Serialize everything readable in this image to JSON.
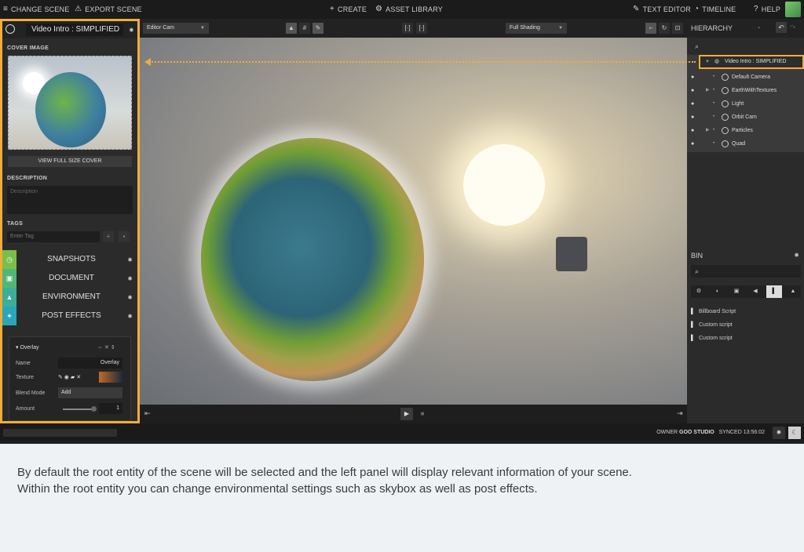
{
  "topbar": {
    "change_scene": "CHANGE SCENE",
    "export_scene": "EXPORT SCENE",
    "create": "CREATE",
    "asset_library": "ASSET LIBRARY",
    "text_editor": "TEXT EDITOR",
    "timeline": "TIMELINE",
    "help": "HELP"
  },
  "left_panel": {
    "title": "Video Intro : SIMPLIFIED",
    "cover_label": "COVER IMAGE",
    "view_cover_button": "VIEW FULL SIZE COVER",
    "description_label": "DESCRIPTION",
    "description_placeholder": "Description",
    "tags_label": "TAGS",
    "tag_placeholder": "Enter Tag",
    "sections": [
      {
        "label": "SNAPSHOTS",
        "color": "#7bbf4b"
      },
      {
        "label": "DOCUMENT",
        "color": "#4fb874"
      },
      {
        "label": "ENVIRONMENT",
        "color": "#3aaf9a"
      },
      {
        "label": "POST EFFECTS",
        "color": "#2aa6b8"
      }
    ],
    "overlay": {
      "title": "Overlay",
      "name_label": "Name",
      "name_value": "Overlay",
      "texture_label": "Texture",
      "blend_label": "Blend Mode",
      "blend_value": "Add",
      "amount_label": "Amount",
      "amount_value": "1"
    }
  },
  "viewport": {
    "camera_dropdown": "Editor Cam",
    "shading_dropdown": "Full Shading"
  },
  "hierarchy": {
    "title": "HIERARCHY",
    "root": "Video Intro : SIMPLIFIED",
    "items": [
      {
        "label": "Default Camera"
      },
      {
        "label": "EarthWithTextures"
      },
      {
        "label": "Light"
      },
      {
        "label": "Orbit Cam"
      },
      {
        "label": "Particles"
      },
      {
        "label": "Quad"
      }
    ]
  },
  "bin": {
    "title": "BIN",
    "items": [
      "Billboard Script",
      "Custom script",
      "Custom script"
    ]
  },
  "status": {
    "owner_label": "OWNER",
    "owner_value": "GOO STUDIO",
    "synced_label": "SYNCED",
    "synced_time": "13:56:02"
  },
  "caption": {
    "line1": "By default the root entity of the scene will be selected and the left panel will display relevant information of your scene.",
    "line2": "Within the root entity you can change environmental settings such as skybox as well as post effects."
  },
  "colors": {
    "highlight": "#f0ad3a"
  }
}
